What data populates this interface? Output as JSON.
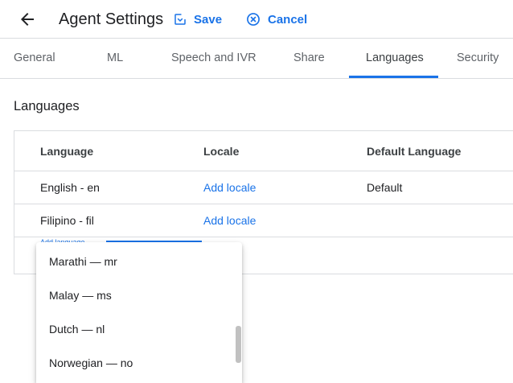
{
  "header": {
    "title": "Agent Settings",
    "save_label": "Save",
    "cancel_label": "Cancel",
    "back_icon": "arrow-back-icon",
    "save_icon": "save-download-icon",
    "cancel_icon": "cancel-circle-icon"
  },
  "tabs": [
    {
      "label": "General"
    },
    {
      "label": "ML"
    },
    {
      "label": "Speech and IVR"
    },
    {
      "label": "Share"
    },
    {
      "label": "Languages",
      "active": true
    },
    {
      "label": "Security"
    }
  ],
  "section": {
    "title": "Languages"
  },
  "table": {
    "columns": [
      "Language",
      "Locale",
      "Default Language"
    ],
    "rows": [
      {
        "language": "English - en",
        "locale": "Add locale",
        "default": "Default"
      },
      {
        "language": "Filipino - fil",
        "locale": "Add locale",
        "default": ""
      }
    ]
  },
  "add_language": {
    "label": "Add language"
  },
  "dropdown": {
    "options": [
      "Marathi — mr",
      "Malay — ms",
      "Dutch — nl",
      "Norwegian — no"
    ]
  },
  "colors": {
    "accent": "#1a73e8",
    "text": "#202124",
    "muted": "#5f6368",
    "divider": "#dadce0"
  }
}
